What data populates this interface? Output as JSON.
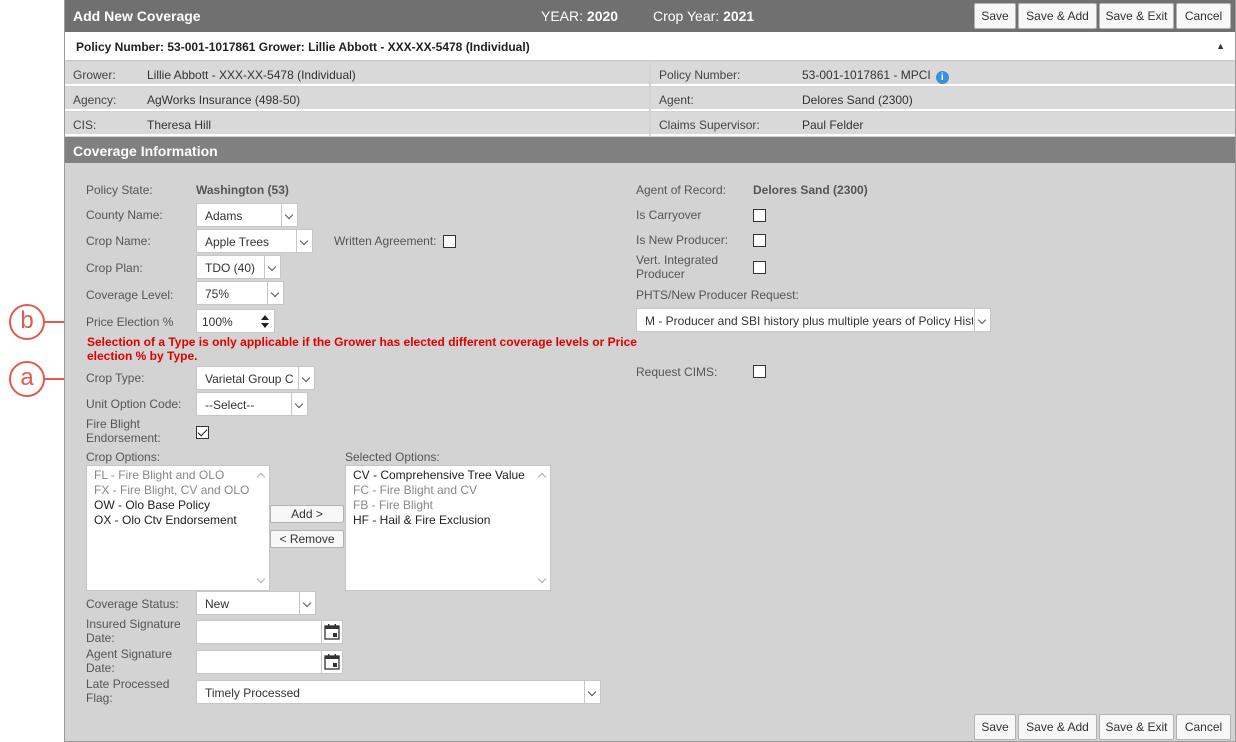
{
  "callouts": {
    "b": "b",
    "a": "a"
  },
  "title_bar": {
    "title": "Add New Coverage",
    "year_label": "YEAR:",
    "year_value": "2020",
    "crop_year_label": "Crop Year:",
    "crop_year_value": "2021"
  },
  "actions": {
    "save": "Save",
    "save_add": "Save & Add",
    "save_exit": "Save & Exit",
    "cancel": "Cancel"
  },
  "policy_bar": {
    "text": "Policy Number: 53-001-1017861 Grower: Lillie Abbott - XXX-XX-5478 (Individual)",
    "collapse_icon": "▲"
  },
  "info": {
    "grower_label": "Grower:",
    "grower_value": "Lillie Abbott - XXX-XX-5478 (Individual)",
    "policy_number_label": "Policy Number:",
    "policy_number_value": "53-001-1017861 - MPCI",
    "agency_label": "Agency:",
    "agency_value": "AgWorks Insurance (498-50)",
    "agent_label": "Agent:",
    "agent_value": "Delores Sand (2300)",
    "cis_label": "CIS:",
    "cis_value": "Theresa Hill",
    "claims_label": "Claims Supervisor:",
    "claims_value": "Paul Felder"
  },
  "section_title": "Coverage Information",
  "form": {
    "policy_state_label": "Policy State:",
    "policy_state_value": "Washington (53)",
    "county_label": "County Name:",
    "county_value": "Adams",
    "crop_name_label": "Crop Name:",
    "crop_name_value": "Apple Trees",
    "written_agreement_label": "Written Agreement:",
    "crop_plan_label": "Crop Plan:",
    "crop_plan_value": "TDO (40)",
    "coverage_level_label": "Coverage Level:",
    "coverage_level_value": "75%",
    "price_election_label": "Price Election %",
    "price_election_value": "100%",
    "type_warning": "Selection of a Type is only applicable if the Grower has elected different coverage levels or Price election % by Type.",
    "crop_type_label": "Crop Type:",
    "crop_type_value": "Varietal Group C",
    "unit_option_label": "Unit Option Code:",
    "unit_option_value": "--Select--",
    "fire_blight_label": "Fire Blight Endorsement:",
    "crop_options_label": "Crop Options:",
    "selected_options_label": "Selected Options:",
    "add_button": "Add >",
    "remove_button": "< Remove",
    "coverage_status_label": "Coverage Status:",
    "coverage_status_value": "New",
    "insured_signature_label": "Insured Signature Date:",
    "agent_signature_label": "Agent Signature Date:",
    "late_processed_label": "Late Processed Flag:",
    "late_processed_value": "Timely Processed",
    "agent_of_record_label": "Agent of Record:",
    "agent_of_record_value": "Delores Sand (2300)",
    "is_carryover_label": "Is Carryover",
    "is_new_producer_label": "Is New Producer:",
    "vert_integrated_label": "Vert. Integrated Producer",
    "phts_label": "PHTS/New Producer Request:",
    "phts_value": "M - Producer and SBI history plus multiple years of Policy History",
    "request_cims_label": "Request CIMS:"
  },
  "crop_options": [
    {
      "text": "FL - Fire Blight and OLO",
      "dim": true
    },
    {
      "text": "FX - Fire Blight, CV and OLO",
      "dim": true
    },
    {
      "text": "OW - Olo Base Policy",
      "dim": false
    },
    {
      "text": "OX - Olo Ctv Endorsement",
      "dim": false
    }
  ],
  "selected_options": [
    {
      "text": "CV - Comprehensive Tree Value",
      "dim": false
    },
    {
      "text": "FC - Fire Blight and CV",
      "dim": true
    },
    {
      "text": "FB - Fire Blight",
      "dim": true
    },
    {
      "text": "HF - Hail & Fire Exclusion",
      "dim": false
    }
  ]
}
